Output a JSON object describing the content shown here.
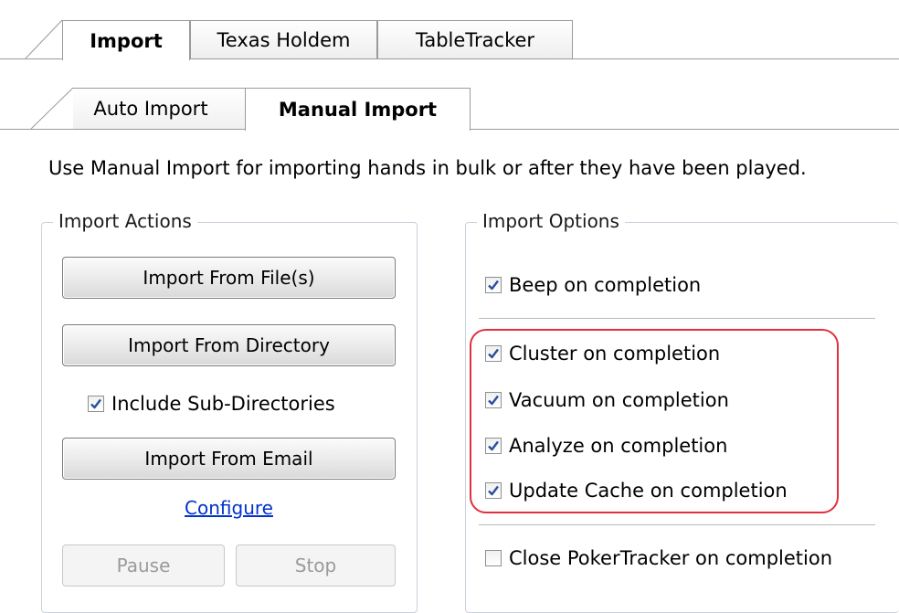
{
  "top_tabs": [
    "Import",
    "Texas Holdem",
    "TableTracker"
  ],
  "sub_tabs": [
    "Auto Import",
    "Manual Import"
  ],
  "description": "Use Manual Import for importing hands in bulk or after they have been played.",
  "import_actions": {
    "title": "Import Actions",
    "import_files_label": "Import From File(s)",
    "import_directory_label": "Import From Directory",
    "include_subdirs_label": "Include Sub-Directories",
    "include_subdirs_checked": true,
    "import_email_label": "Import From Email",
    "configure_label": "Configure",
    "pause_label": "Pause",
    "stop_label": "Stop"
  },
  "import_options": {
    "title": "Import Options",
    "beep_label": "Beep on completion",
    "cluster_label": "Cluster on completion",
    "vacuum_label": "Vacuum on completion",
    "analyze_label": "Analyze on completion",
    "update_cache_label": "Update Cache on completion",
    "close_label": "Close PokerTracker on completion"
  },
  "colors": {
    "highlight": "#e0303f",
    "check": "#2a4f9e",
    "link": "#0033cc"
  }
}
